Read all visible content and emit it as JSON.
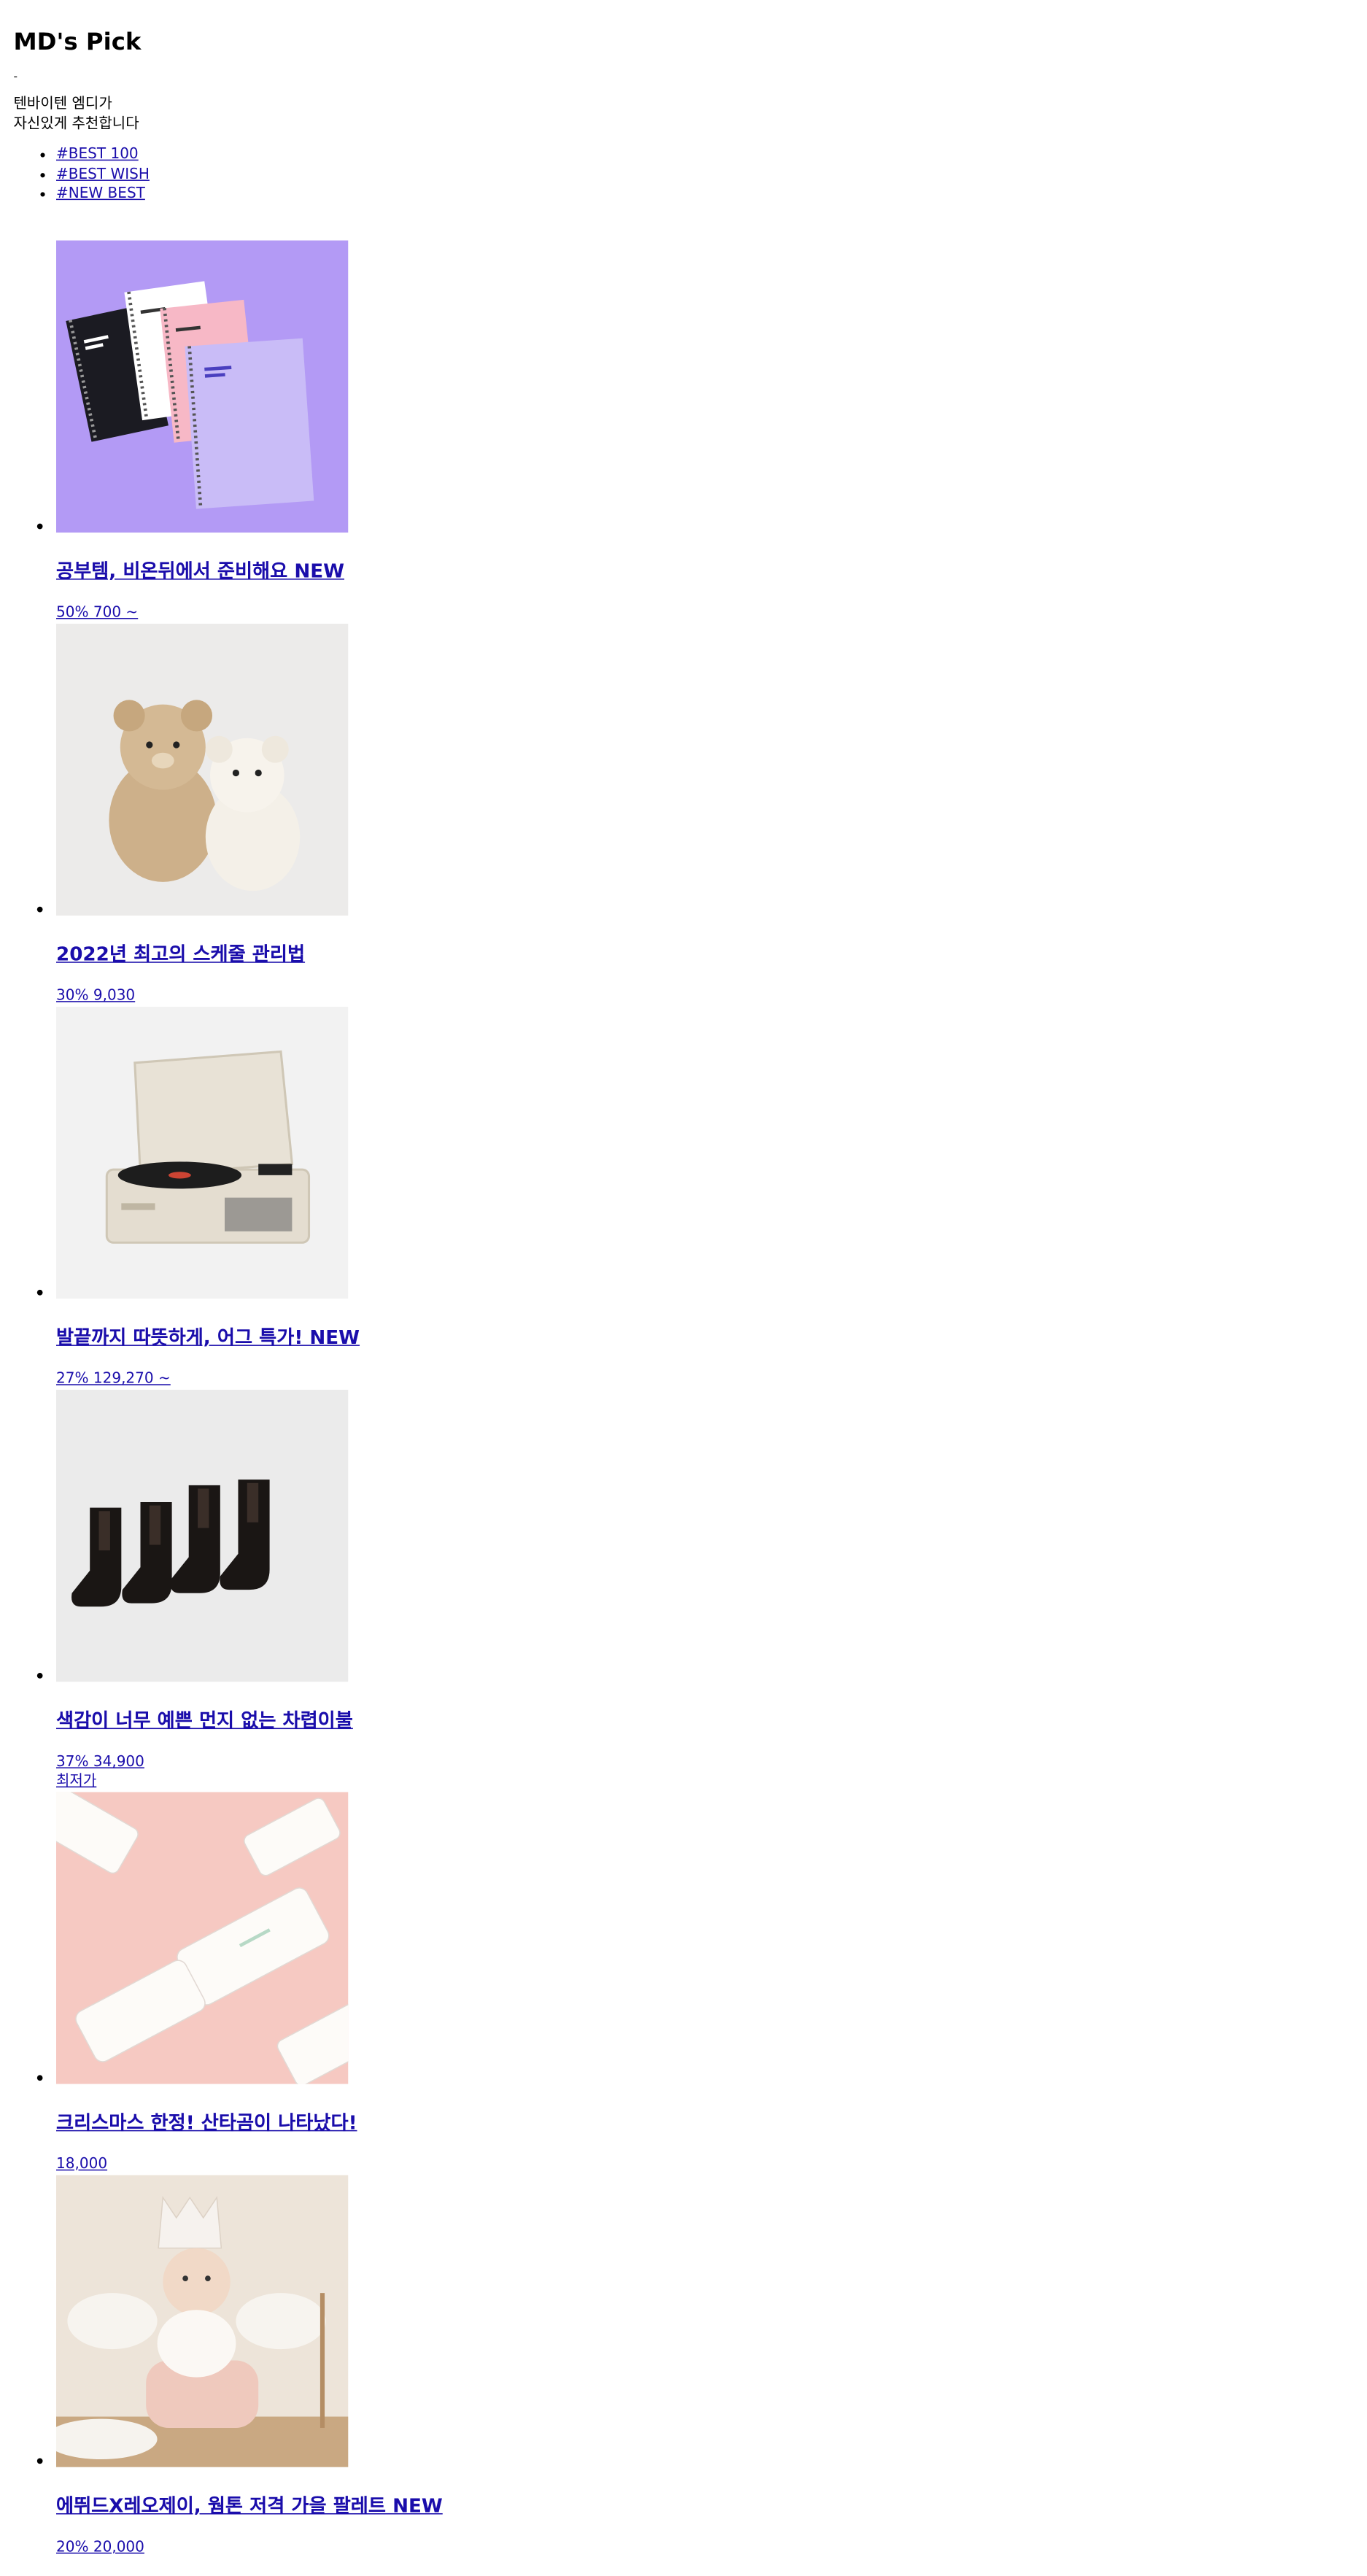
{
  "section": {
    "title": "MD's Pick",
    "dash": "-",
    "desc_line1": "텐바이텐 엠디가",
    "desc_line2": "자신있게 추천합니다"
  },
  "tags": [
    {
      "label": "#BEST 100"
    },
    {
      "label": "#BEST WISH"
    },
    {
      "label": "#NEW BEST"
    }
  ],
  "products": [
    {
      "title": "공부템, 비온뒤에서 준비해요 NEW",
      "price": "50% 700 ~",
      "extra": ""
    },
    {
      "title": "2022년 최고의 스케줄 관리법",
      "price": "30% 9,030",
      "extra": ""
    },
    {
      "title": "발끝까지 따뜻하게, 어그 특가! NEW",
      "price": "27% 129,270 ~",
      "extra": ""
    },
    {
      "title": "색감이 너무 예쁜 먼지 없는 차렵이불",
      "price": "37% 34,900",
      "extra": "최저가"
    },
    {
      "title": "크리스마스 한정! 산타곰이 나타났다!",
      "price": "18,000",
      "extra": ""
    },
    {
      "title": "에뛰드X레오제이, 웜톤 저격 가을 팔레트 NEW",
      "price": "20% 20,000",
      "extra": ""
    }
  ]
}
